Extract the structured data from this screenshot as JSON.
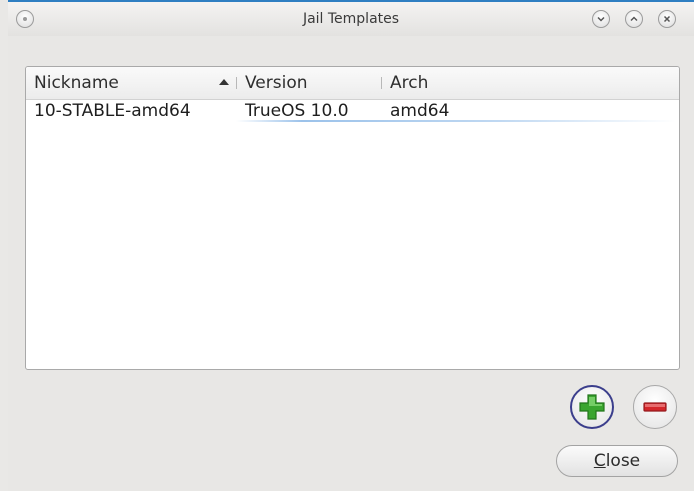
{
  "window": {
    "title": "Jail Templates"
  },
  "table": {
    "columns": [
      "Nickname",
      "Version",
      "Arch"
    ],
    "sort_column": "Nickname",
    "sort_direction": "ascending",
    "rows": [
      {
        "nickname": "10-STABLE-amd64",
        "version": "TrueOS 10.0",
        "arch": "amd64"
      }
    ]
  },
  "buttons": {
    "add_icon": "plus-icon",
    "remove_icon": "minus-icon",
    "close_mnemonic": "C",
    "close_rest": "lose"
  },
  "colors": {
    "accent": "#2f7fc2",
    "add_green": "#3aa52f",
    "remove_red": "#d4262a"
  }
}
